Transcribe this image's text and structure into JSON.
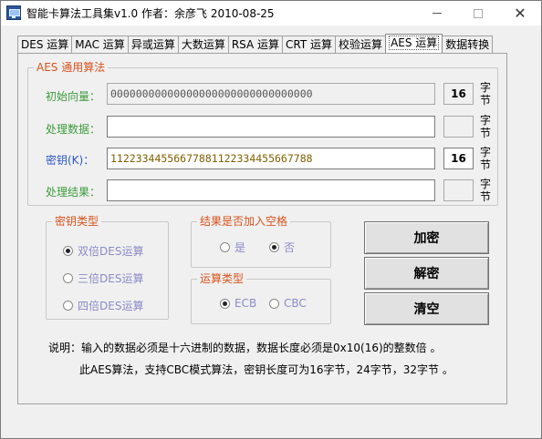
{
  "window": {
    "title": "智能卡算法工具集v1.0  作者：余彦飞 2010-08-25",
    "controls": {
      "minimize": "─",
      "maximize": "☐",
      "close": "✕"
    }
  },
  "tabs": [
    {
      "label": "DES 运算",
      "active": false
    },
    {
      "label": "MAC 运算",
      "active": false
    },
    {
      "label": "异或运算",
      "active": false
    },
    {
      "label": "大数运算",
      "active": false
    },
    {
      "label": "RSA 运算",
      "active": false
    },
    {
      "label": "CRT 运算",
      "active": false
    },
    {
      "label": "校验运算",
      "active": false
    },
    {
      "label": "AES 运算",
      "active": true
    },
    {
      "label": "数据转换",
      "active": false
    }
  ],
  "aes_group": {
    "title": "AES 通用算法",
    "iv": {
      "label": "初始向量：",
      "value": "00000000000000000000000000000000",
      "length": "16",
      "unit": "字节"
    },
    "data": {
      "label": "处理数据：",
      "value": "",
      "length": "",
      "unit": "字节"
    },
    "key": {
      "label": "密钥(K)：",
      "value": "11223344556677881122334455667788",
      "length": "16",
      "unit": "字节"
    },
    "result": {
      "label": "处理结果：",
      "value": "",
      "length": "",
      "unit": "字节"
    }
  },
  "key_type": {
    "title": "密钥类型",
    "options": [
      {
        "label": "双倍DES运算",
        "selected": true
      },
      {
        "label": "三倍DES运算",
        "selected": false
      },
      {
        "label": "四倍DES运算",
        "selected": false
      }
    ]
  },
  "space_group": {
    "title": "结果是否加入空格",
    "options": [
      {
        "label": "是",
        "selected": false
      },
      {
        "label": "否",
        "selected": true
      }
    ]
  },
  "op_group": {
    "title": "运算类型",
    "options": [
      {
        "label": "ECB",
        "selected": true
      },
      {
        "label": "CBC",
        "selected": false
      }
    ]
  },
  "buttons": {
    "encrypt": "加密",
    "decrypt": "解密",
    "clear": "清空"
  },
  "notes": {
    "line1": "说明：输入的数据必须是十六进制的数据，数据长度必须是0x10(16)的整数倍 。",
    "line2": "此AES算法，支持CBC模式算法，密钥长度可为16字节，24字节，32字节 。"
  },
  "colors": {
    "group_title": "#d9531e",
    "field_label": "#3c9c3c",
    "radio_label": "#8a8ac8",
    "key_text": "#806000"
  }
}
